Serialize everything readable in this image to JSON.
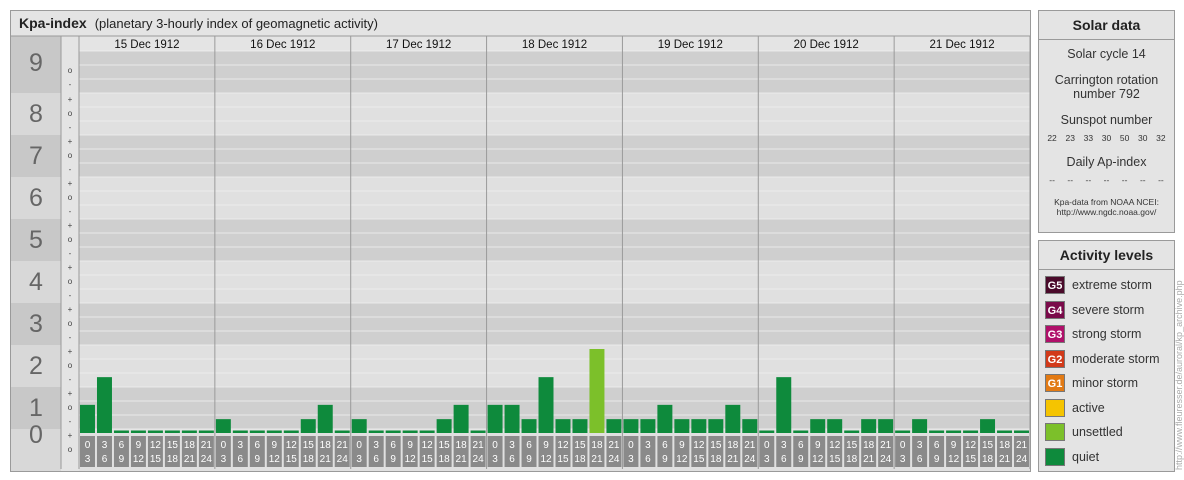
{
  "header": {
    "title": "Kpa-index",
    "subtitle": "(planetary 3-hourly index of geomagnetic activity)"
  },
  "chart_data": {
    "type": "bar",
    "ylim": [
      0,
      9
    ],
    "y_ticks": [
      "0",
      "1",
      "2",
      "3",
      "4",
      "5",
      "6",
      "7",
      "8",
      "9"
    ],
    "sub_ticks": [
      "+",
      "o",
      "-"
    ],
    "days": [
      "15 Dec 1912",
      "16 Dec 1912",
      "17 Dec 1912",
      "18 Dec 1912",
      "19 Dec 1912",
      "20 Dec 1912",
      "21 Dec 1912"
    ],
    "interval_labels": [
      [
        "0",
        "3"
      ],
      [
        "3",
        "6"
      ],
      [
        "6",
        "9"
      ],
      [
        "9",
        "12"
      ],
      [
        "12",
        "15"
      ],
      [
        "15",
        "18"
      ],
      [
        "18",
        "21"
      ],
      [
        "21",
        "24"
      ]
    ],
    "values": [
      [
        0.67,
        1.33,
        0.0,
        0.0,
        0.0,
        0.0,
        0.0,
        0.0
      ],
      [
        0.33,
        0.0,
        0.0,
        0.0,
        0.0,
        0.33,
        0.67,
        0.0
      ],
      [
        0.33,
        0.0,
        0.0,
        0.0,
        0.0,
        0.33,
        0.67,
        0.0
      ],
      [
        0.67,
        0.67,
        0.33,
        1.33,
        0.33,
        0.33,
        2.0,
        0.33
      ],
      [
        0.33,
        0.33,
        0.67,
        0.33,
        0.33,
        0.33,
        0.67,
        0.33
      ],
      [
        0.0,
        1.33,
        0.0,
        0.33,
        0.33,
        0.0,
        0.33,
        0.33
      ],
      [
        0.0,
        0.33,
        0.0,
        0.0,
        0.0,
        0.33,
        0.0,
        0.0
      ]
    ],
    "colors": {
      "quiet": "#0e8a3c",
      "unsettled": "#7cc02a"
    }
  },
  "solar": {
    "heading": "Solar data",
    "cycle": "Solar cycle 14",
    "carrington_line1": "Carrington rotation",
    "carrington_line2": "number 792",
    "sunspot_heading": "Sunspot number",
    "sunspots": [
      "22",
      "23",
      "33",
      "30",
      "50",
      "30",
      "32"
    ],
    "ap_heading": "Daily Ap-index",
    "ap_values": [
      "--",
      "--",
      "--",
      "--",
      "--",
      "--",
      "--"
    ],
    "source_line1": "Kpa-data from NOAA NCEI:",
    "source_line2": "http://www.ngdc.noaa.gov/"
  },
  "activity": {
    "heading": "Activity levels",
    "levels": [
      {
        "badge": "G5",
        "label": "extreme storm",
        "color": "#4a0a2a"
      },
      {
        "badge": "G4",
        "label": "severe storm",
        "color": "#7a0a4a"
      },
      {
        "badge": "G3",
        "label": "strong storm",
        "color": "#b0106a"
      },
      {
        "badge": "G2",
        "label": "moderate storm",
        "color": "#d23a1a"
      },
      {
        "badge": "G1",
        "label": "minor storm",
        "color": "#e27a14"
      },
      {
        "badge": "",
        "label": "active",
        "color": "#f5c400"
      },
      {
        "badge": "",
        "label": "unsettled",
        "color": "#7cc02a"
      },
      {
        "badge": "",
        "label": "quiet",
        "color": "#0e8a3c"
      }
    ]
  },
  "credit": "http://www.fleuresser.de/auroral/kp_archive.php"
}
